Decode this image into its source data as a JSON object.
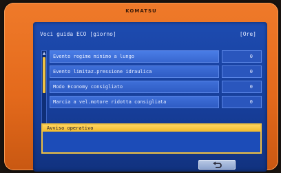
{
  "device": {
    "brand": "KOMATSU"
  },
  "screen": {
    "title": "Voci guida ECO [giorno]",
    "unit": "[Ore]",
    "rows": [
      {
        "label": "Evento regime minimo a lungo",
        "value": "0"
      },
      {
        "label": "Evento limitaz.pressione idraulica",
        "value": "0"
      },
      {
        "label": "Modo Economy consigliato",
        "value": "0"
      },
      {
        "label": "Marcia a vel.motore ridotta consigliata",
        "value": "0"
      }
    ],
    "notice": {
      "title": "Avviso operativo"
    },
    "back_icon": "return-arrow-icon"
  },
  "colors": {
    "bezel": "#e46a1c",
    "screen": "#163d98",
    "highlight": "#f0c243"
  }
}
